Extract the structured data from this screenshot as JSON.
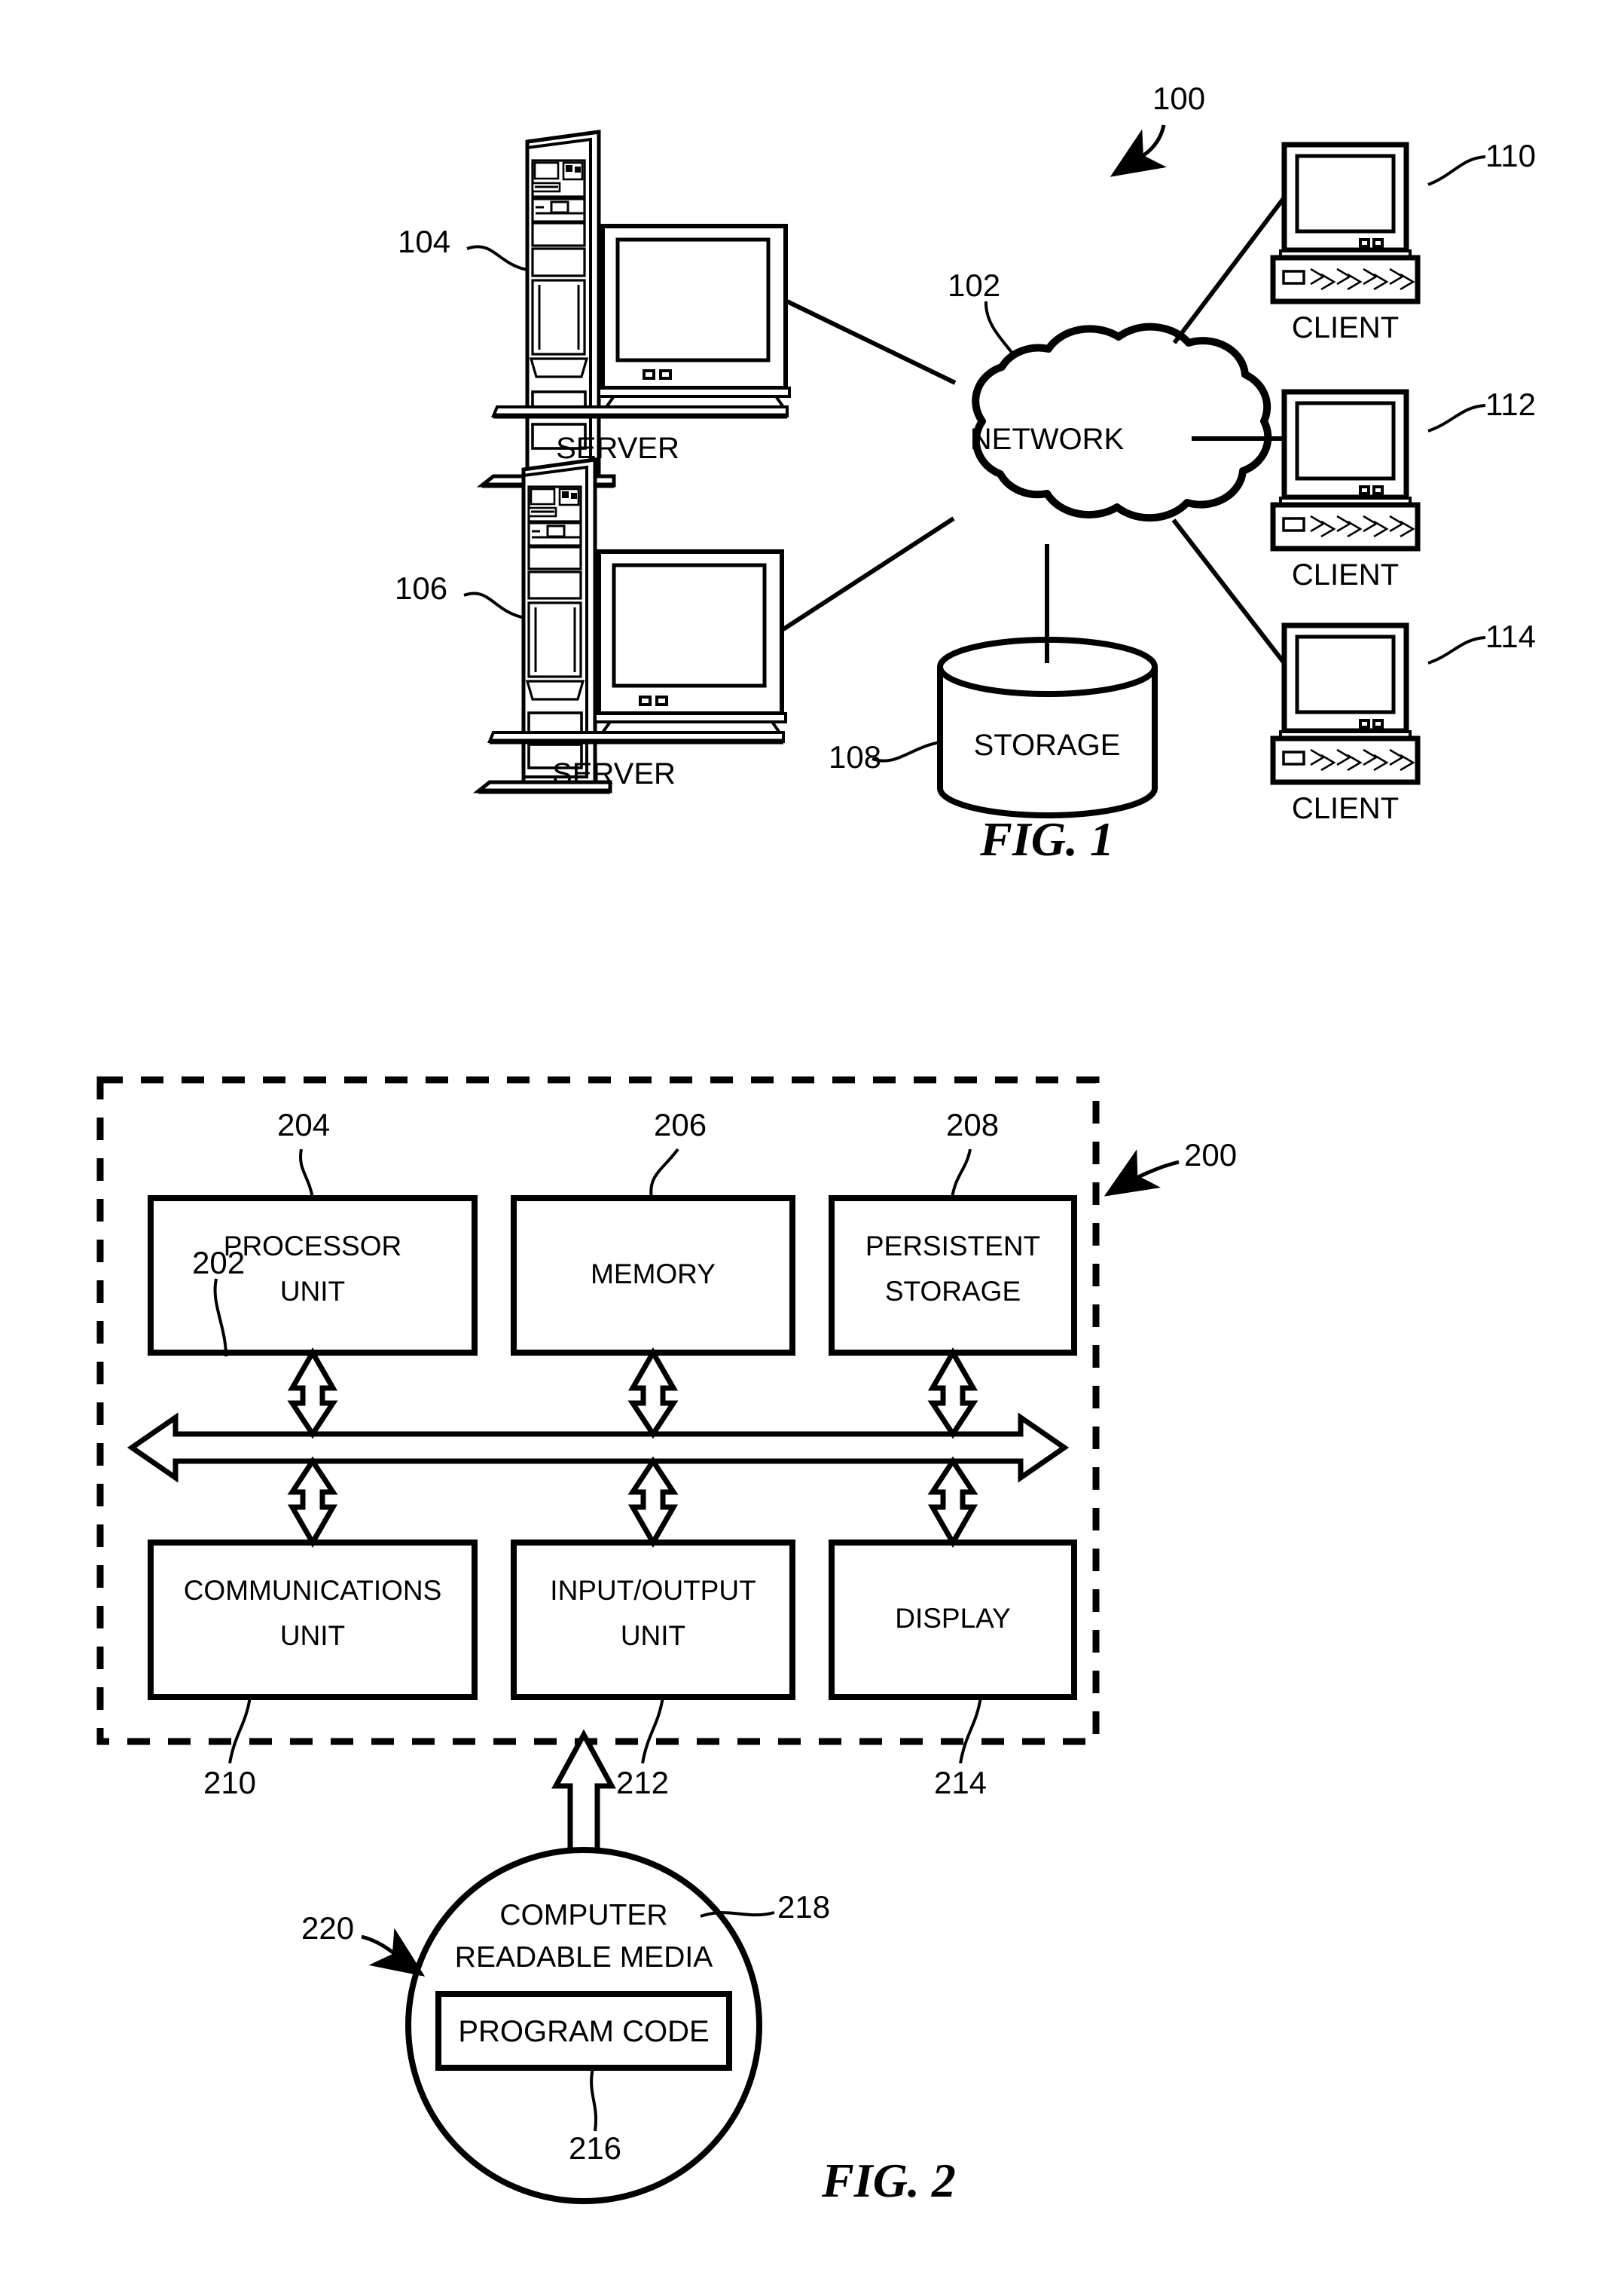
{
  "figures": [
    {
      "id": "figure-1",
      "title": "FIG. 1",
      "ref_number": "100",
      "nodes": [
        {
          "name": "server-104",
          "label": "SERVER",
          "ref": "104"
        },
        {
          "name": "server-106",
          "label": "SERVER",
          "ref": "106"
        },
        {
          "name": "network-cloud",
          "label": "NETWORK",
          "ref": "102"
        },
        {
          "name": "storage-cylinder",
          "label": "STORAGE",
          "ref": "108"
        },
        {
          "name": "client-110",
          "label": "CLIENT",
          "ref": "110"
        },
        {
          "name": "client-112",
          "label": "CLIENT",
          "ref": "112"
        },
        {
          "name": "client-114",
          "label": "CLIENT",
          "ref": "114"
        }
      ]
    },
    {
      "id": "figure-2",
      "title": "FIG. 2",
      "ref_number": "200",
      "bus": {
        "name": "system-bus",
        "ref": "202"
      },
      "top_boxes": [
        {
          "name": "processor-unit-box",
          "line1": "PROCESSOR",
          "line2": "UNIT",
          "ref": "204"
        },
        {
          "name": "memory-box",
          "line1": "MEMORY",
          "line2": "",
          "ref": "206"
        },
        {
          "name": "persistent-storage-box",
          "line1": "PERSISTENT",
          "line2": "STORAGE",
          "ref": "208"
        }
      ],
      "bottom_boxes": [
        {
          "name": "communications-unit-box",
          "line1": "COMMUNICATIONS",
          "line2": "UNIT",
          "ref": "210"
        },
        {
          "name": "input-output-unit-box",
          "line1": "INPUT/OUTPUT",
          "line2": "UNIT",
          "ref": "212"
        },
        {
          "name": "display-box",
          "line1": "DISPLAY",
          "line2": "",
          "ref": "214"
        }
      ],
      "media": {
        "name": "computer-readable-media",
        "line1": "COMPUTER",
        "line2": "READABLE MEDIA",
        "ref": "218",
        "outer_ref": "220",
        "program_code": {
          "name": "program-code-box",
          "label": "PROGRAM CODE",
          "ref": "216"
        }
      }
    }
  ],
  "colors": {
    "ink": "#000000",
    "paper": "#ffffff"
  }
}
